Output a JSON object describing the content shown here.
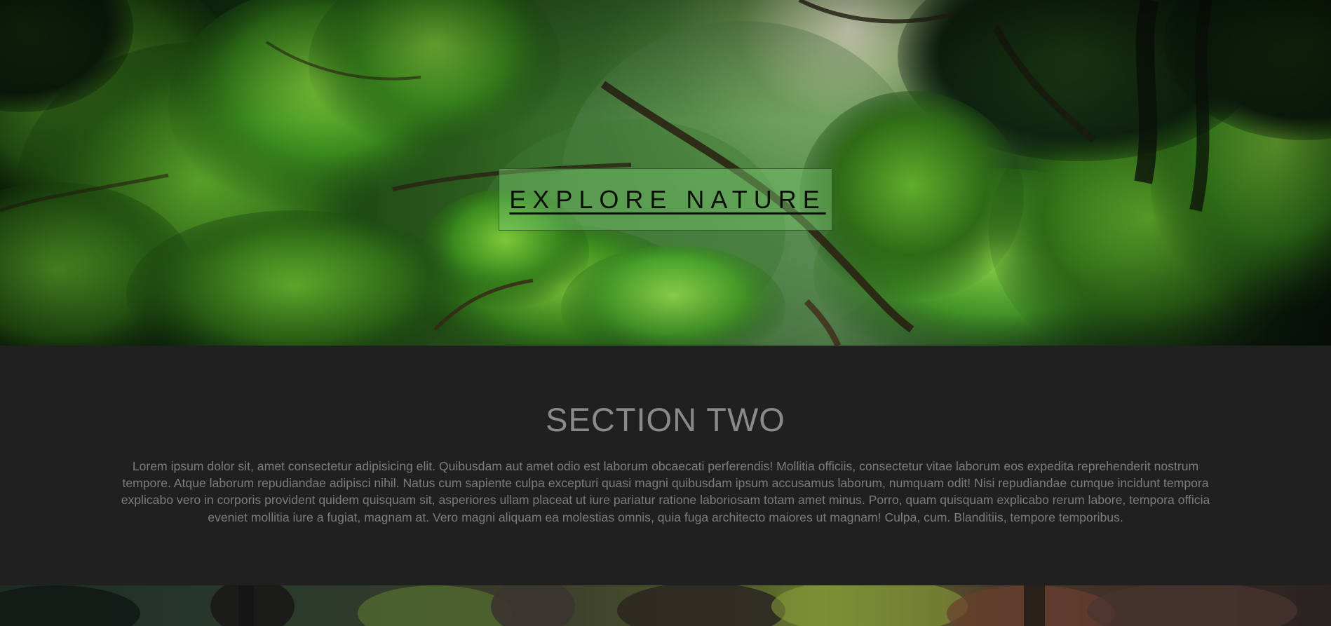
{
  "hero": {
    "title": "EXPLORE NATURE"
  },
  "section_two": {
    "heading": "SECTION TWO",
    "body": "Lorem ipsum dolor sit, amet consectetur adipisicing elit. Quibusdam aut amet odio est laborum obcaecati perferendis! Mollitia officiis, consectetur vitae laborum eos expedita reprehenderit nostrum tempore. Atque laborum repudiandae adipisci nihil. Natus cum sapiente culpa excepturi quasi magni quibusdam ipsum accusamus laborum, numquam odit! Nisi repudiandae cumque incidunt tempora explicabo vero in corporis provident quidem quisquam sit, asperiores ullam placeat ut iure pariatur ratione laboriosam totam amet minus. Porro, quam quisquam explicabo rerum labore, tempora officia eveniet mollitia iure a fugiat, magnam at. Vero magni aliquam ea molestias omnis, quia fuga architecto maiores ut magnam! Culpa, cum. Blanditiis, tempore temporibus."
  },
  "colors": {
    "section_background": "#202020",
    "heading_text": "#8a8a8a",
    "body_text": "#7c7c7c",
    "hero_title_text": "#0a0f08",
    "hero_title_box": "rgba(120,200,110,0.45)"
  }
}
